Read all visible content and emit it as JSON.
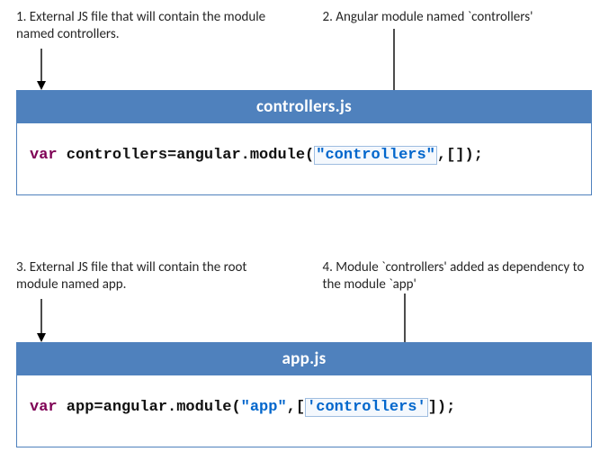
{
  "captions": {
    "c1": "1. External JS file that will contain the module named controllers.",
    "c2": "2. Angular module named  `controllers'",
    "c3": "3. External JS file that will contain the root module named app.",
    "c4": "4. Module `controllers' added as dependency to the module `app'"
  },
  "cards": {
    "controllers": {
      "title": "controllers.js",
      "code": {
        "var": "var",
        "ident": " controllers=angular.module(",
        "str": "\"controllers\"",
        "tail": ",[]);"
      }
    },
    "app": {
      "title": "app.js",
      "code": {
        "var": "var",
        "ident": " app=angular.module(",
        "str1": "\"app\"",
        "mid": ",[",
        "str2": "'controllers'",
        "tail": "]);"
      }
    }
  }
}
